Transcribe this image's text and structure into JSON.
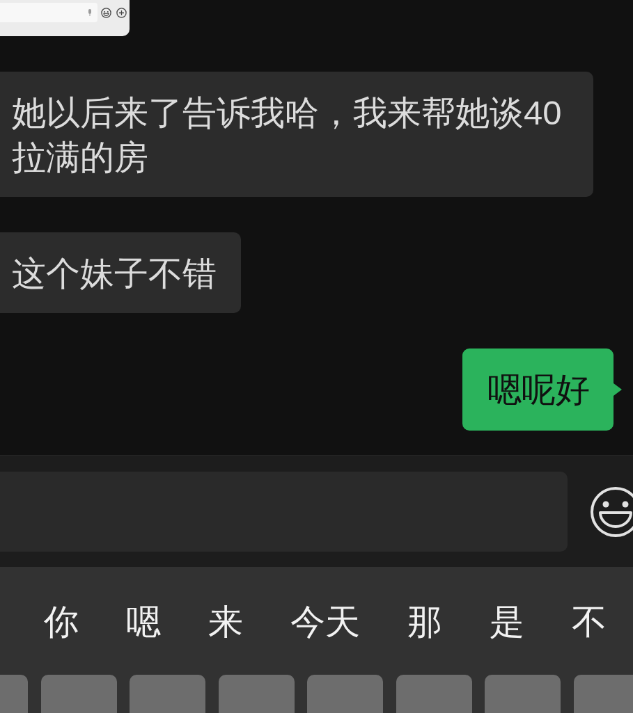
{
  "messages": [
    {
      "kind": "image",
      "outgoing": false
    },
    {
      "kind": "text",
      "outgoing": false,
      "text": "她以后来了告诉我哈，我来帮她谈40拉满的房"
    },
    {
      "kind": "text",
      "outgoing": false,
      "text": "这个妹子不错"
    },
    {
      "kind": "text",
      "outgoing": true,
      "text": "嗯呢好"
    }
  ],
  "keyboard": {
    "candidates": [
      "你",
      "嗯",
      "来",
      "今天",
      "那",
      "是",
      "不"
    ]
  }
}
